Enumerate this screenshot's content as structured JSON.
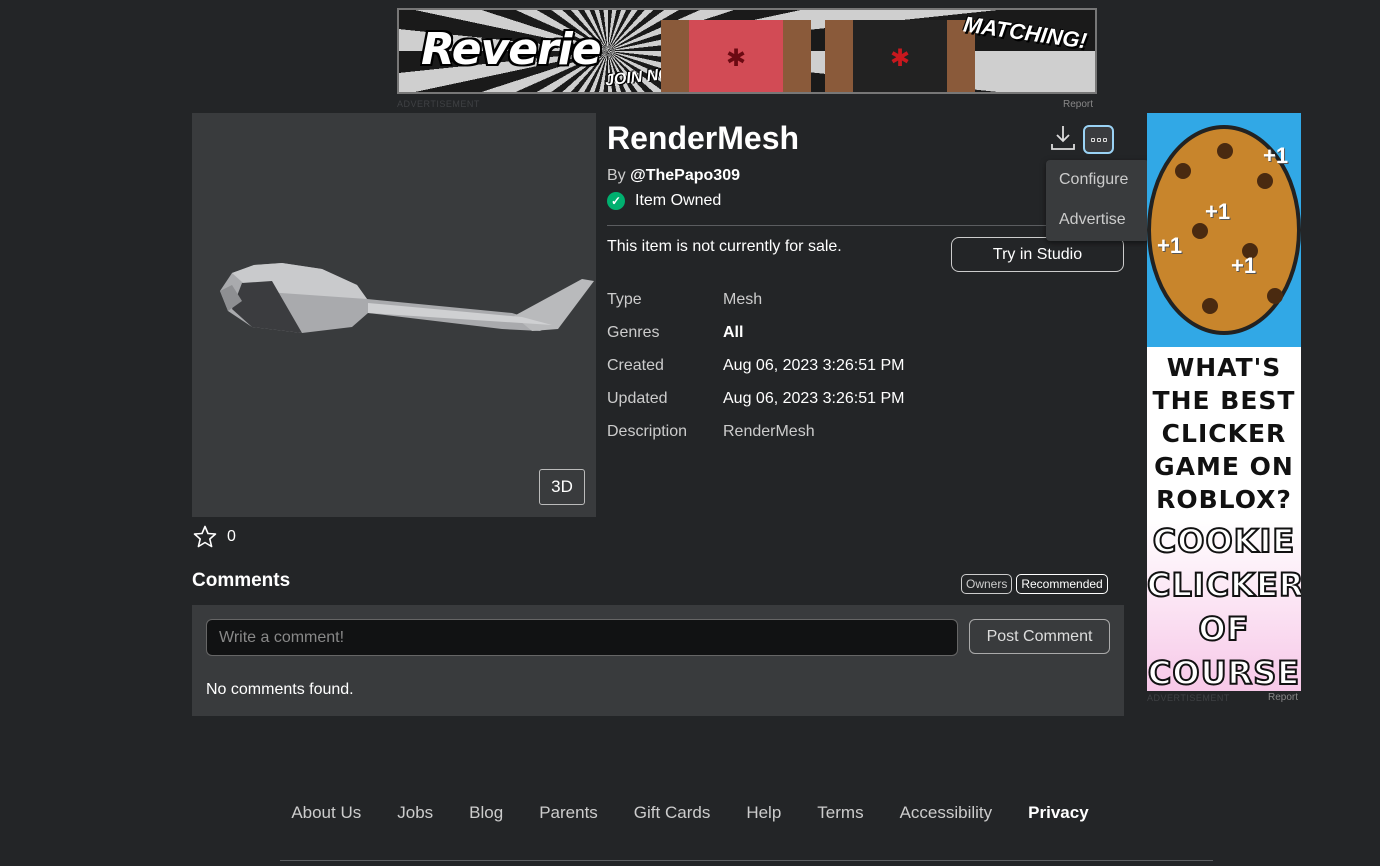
{
  "top_ad": {
    "brand": "Reverie",
    "cta": "JOIN NOW!",
    "tagline": "MATCHING!",
    "label": "ADVERTISEMENT",
    "report": "Report"
  },
  "item": {
    "title": "RenderMesh",
    "by_prefix": "By",
    "creator": "@ThePapo309",
    "owned_label": "Item Owned",
    "sale_note": "This item is not currently for sale.",
    "try_button": "Try in Studio",
    "view_3d": "3D",
    "favorites": "0",
    "details": [
      {
        "key": "Type",
        "value": "Mesh"
      },
      {
        "key": "Genres",
        "value": "All"
      },
      {
        "key": "Created",
        "value": "Aug 06, 2023 3:26:51 PM"
      },
      {
        "key": "Updated",
        "value": "Aug 06, 2023 3:26:51 PM"
      },
      {
        "key": "Description",
        "value": "RenderMesh"
      }
    ]
  },
  "menu": {
    "items": [
      "Configure",
      "Advertise"
    ]
  },
  "side_ad": {
    "question": [
      "WHAT'S",
      "THE BEST",
      "CLICKER",
      "GAME ON",
      "ROBLOX?"
    ],
    "answer": [
      "COOKIE",
      "CLICKER",
      "OF",
      "COURSE"
    ],
    "plus": "+1",
    "label": "ADVERTISEMENT",
    "report": "Report"
  },
  "comments": {
    "title": "Comments",
    "sort_owners": "Owners",
    "sort_recommended": "Recommended",
    "input_placeholder": "Write a comment!",
    "post_button": "Post Comment",
    "empty_text": "No comments found."
  },
  "footer": {
    "links": [
      "About Us",
      "Jobs",
      "Blog",
      "Parents",
      "Gift Cards",
      "Help",
      "Terms",
      "Accessibility",
      "Privacy"
    ]
  },
  "colors": {
    "background": "#232527",
    "panel": "#393b3d",
    "owned_green": "#00b06f",
    "focus_blue": "#9ad3f5"
  }
}
